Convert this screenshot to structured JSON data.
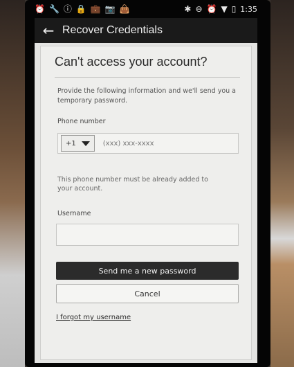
{
  "status_bar": {
    "left_icons": [
      "alarm-icon",
      "wrench-icon",
      "info-icon",
      "lock-icon",
      "briefcase-icon",
      "camera-icon",
      "bag-icon"
    ],
    "right_icons": [
      "bluetooth-icon",
      "minus-circle-icon",
      "alarm-icon",
      "wifi-icon",
      "battery-icon"
    ],
    "time": "1:35"
  },
  "app_bar": {
    "back_glyph": "←",
    "title": "Recover Credentials"
  },
  "form": {
    "title": "Can't access your account?",
    "intro": "Provide the following information and we'll send you a temporary password.",
    "phone_label": "Phone number",
    "country_code": "+1",
    "phone_placeholder": "(xxx) xxx-xxxx",
    "phone_hint": "This phone number must be already added to your account.",
    "username_label": "Username",
    "username_value": "",
    "submit_label": "Send me a new password",
    "cancel_label": "Cancel",
    "forgot_username_label": "I forgot my username"
  }
}
